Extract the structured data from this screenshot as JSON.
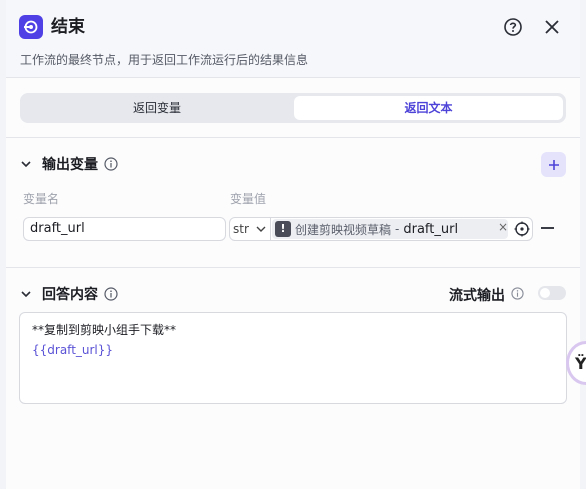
{
  "header": {
    "title": "结束",
    "subtitle": "工作流的最终节点，用于返回工作流运行后的结果信息",
    "icons": [
      "end-node-icon",
      "help-icon",
      "close-icon"
    ],
    "accent": "#4e40e5"
  },
  "tabs": [
    {
      "label": "返回变量",
      "active": false
    },
    {
      "label": "返回文本",
      "active": true
    }
  ],
  "output": {
    "title": "输出变量",
    "col_name": "变量名",
    "col_value": "变量值",
    "rows": [
      {
        "name": "draft_url",
        "type": "str",
        "ref_node": "创建剪映视频草稿",
        "ref_sep": "-",
        "ref_var": "draft_url",
        "chip_close": "×"
      }
    ]
  },
  "answer": {
    "title": "回答内容",
    "stream_label": "流式输出",
    "stream_enabled": false,
    "line1": "**复制到剪映小组手下载**",
    "line2": "{{draft_url}}"
  },
  "float_ball": {
    "glyph": "Ϋ"
  }
}
